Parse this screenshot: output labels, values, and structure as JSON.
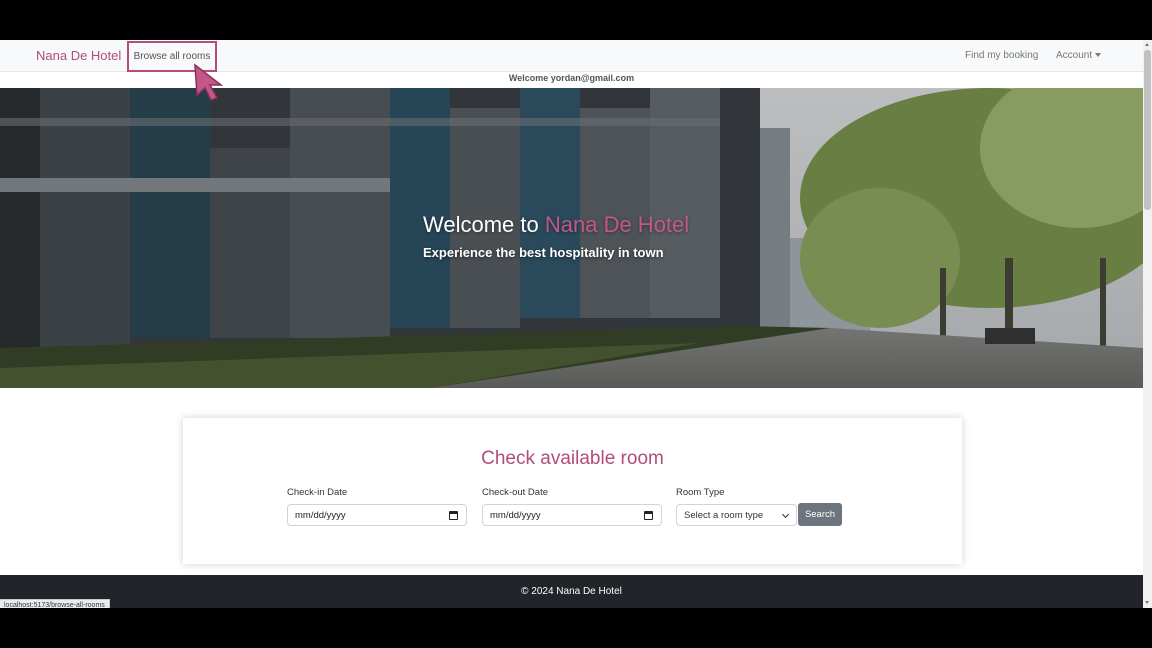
{
  "navbar": {
    "brand": "Nana De Hotel",
    "browse_label": "Browse all rooms",
    "find_booking_label": "Find my booking",
    "account_label": "Account"
  },
  "welcome_text": "Welcome yordan@gmail.com",
  "hero": {
    "title_prefix": "Welcome to ",
    "title_brand": "Nana De Hotel",
    "subtitle": "Experience the best hospitality in town"
  },
  "booking": {
    "title": "Check available room",
    "checkin_label": "Check-in Date",
    "checkin_placeholder": "mm/dd/yyyy",
    "checkout_label": "Check-out Date",
    "checkout_placeholder": "mm/dd/yyyy",
    "room_type_label": "Room Type",
    "room_type_selected": "Select a room type",
    "search_label": "Search"
  },
  "footer": {
    "copyright": "© 2024 Nana De Hotel"
  },
  "status_url": "localhost:5173/browse-all-rooms",
  "colors": {
    "brand": "#b24c7a",
    "footer_bg": "#212529",
    "search_btn": "#6c757d"
  }
}
